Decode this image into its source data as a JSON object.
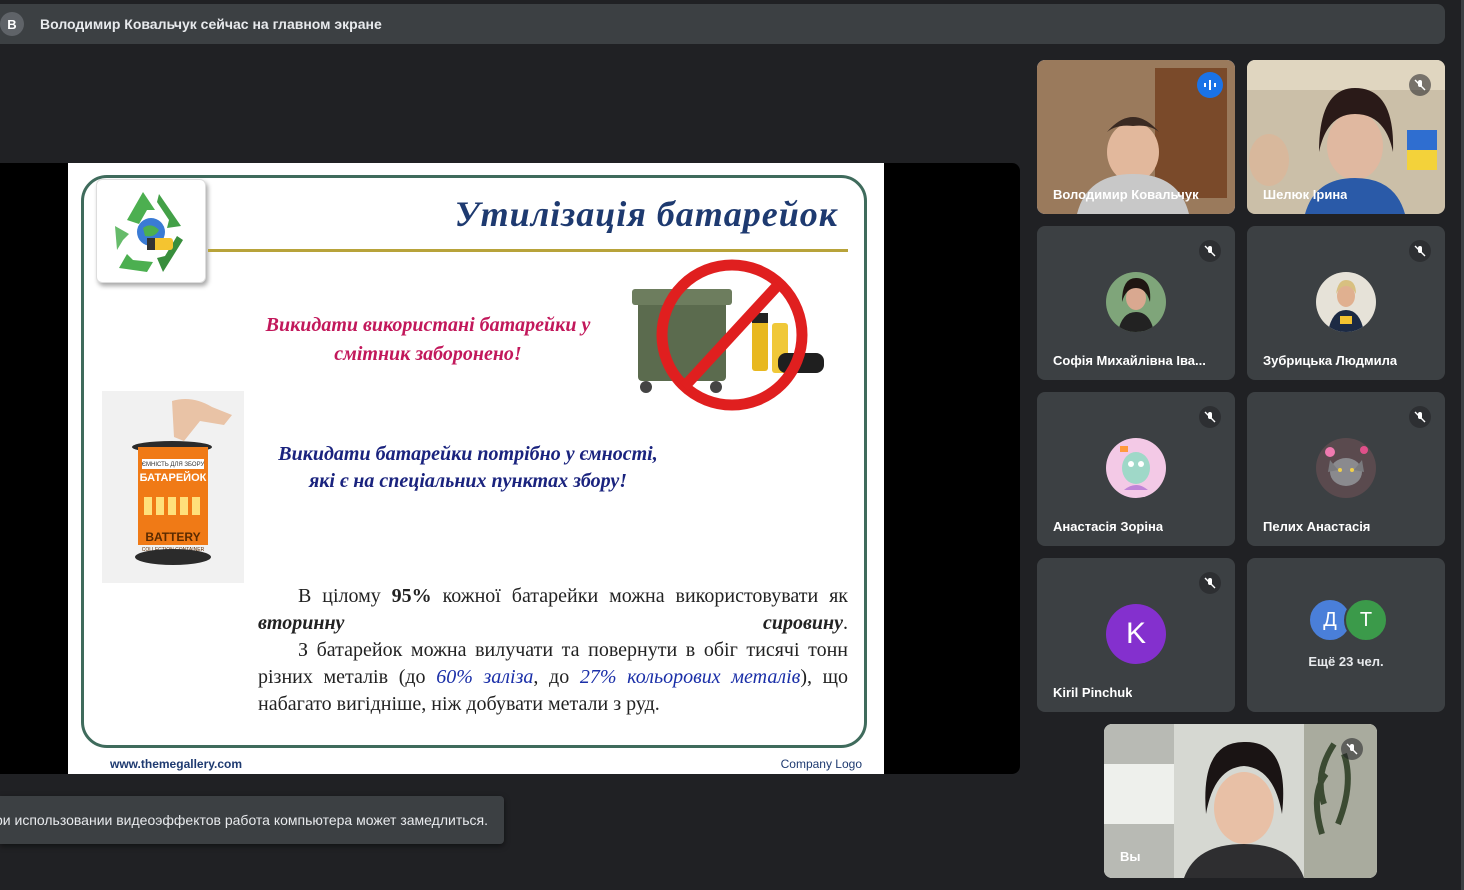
{
  "banner": {
    "avatar_letter": "В",
    "text": "Володимир Ковальчук сейчас на главном экране"
  },
  "slide": {
    "title": "Утилізація батарейок",
    "warning": "Викидати використані батарейки у смітник заборонено!",
    "collect": "Викидати батарейки потрібно у ємності, які є на спеціальних пунктах збору!",
    "para1_a": "В цілому",
    "para1_pct": "95%",
    "para1_b": "кожної батарейки можна використовувати як",
    "para1_em": "вторинну сировину",
    "para1_end": ".",
    "para2_a": "З батарейок можна вилучати та повернути в обіг тисячі тонн різних металів (до",
    "para2_iron": "60% заліза",
    "para2_mid": ", до",
    "para2_color": "27% кольорових металів",
    "para2_end": "), що набагато вигідніше, ніж добувати метали з руд.",
    "container_top": "ЄМНІСТЬ ДЛЯ ЗБОРУ",
    "container_main": "БАТАРЕЙОК",
    "container_brand": "BATTERY",
    "container_sub": "COLLECTION CONTAINER",
    "footer_left": "www.themegallery.com",
    "footer_right": "Company Logo"
  },
  "participants": [
    {
      "name": "Володимир Ковальчук",
      "speaking": true
    },
    {
      "name": "Шелюк Ірина",
      "muted": true
    },
    {
      "name": "Софія Михайлівна Іва...",
      "muted": true
    },
    {
      "name": "Зубрицька Людмила",
      "muted": true
    },
    {
      "name": "Анастасія Зоріна",
      "muted": true
    },
    {
      "name": "Пелих Анастасія",
      "muted": true
    },
    {
      "name": "Kiril Pinchuk",
      "muted": true,
      "initial": "K"
    }
  ],
  "more": {
    "initials": [
      "Д",
      "Т"
    ],
    "colors": [
      "#4a7fd9",
      "#3b9a4a"
    ],
    "text": "Ещё 23 чел."
  },
  "self": {
    "name": "Вы"
  },
  "toast": {
    "text": "При использовании видеоэффектов работа компьютера может замедлиться."
  },
  "colors": {
    "accent": "#8ab4f8",
    "speaking": "#1a73e8",
    "avatar_purple": "#8430ce"
  }
}
